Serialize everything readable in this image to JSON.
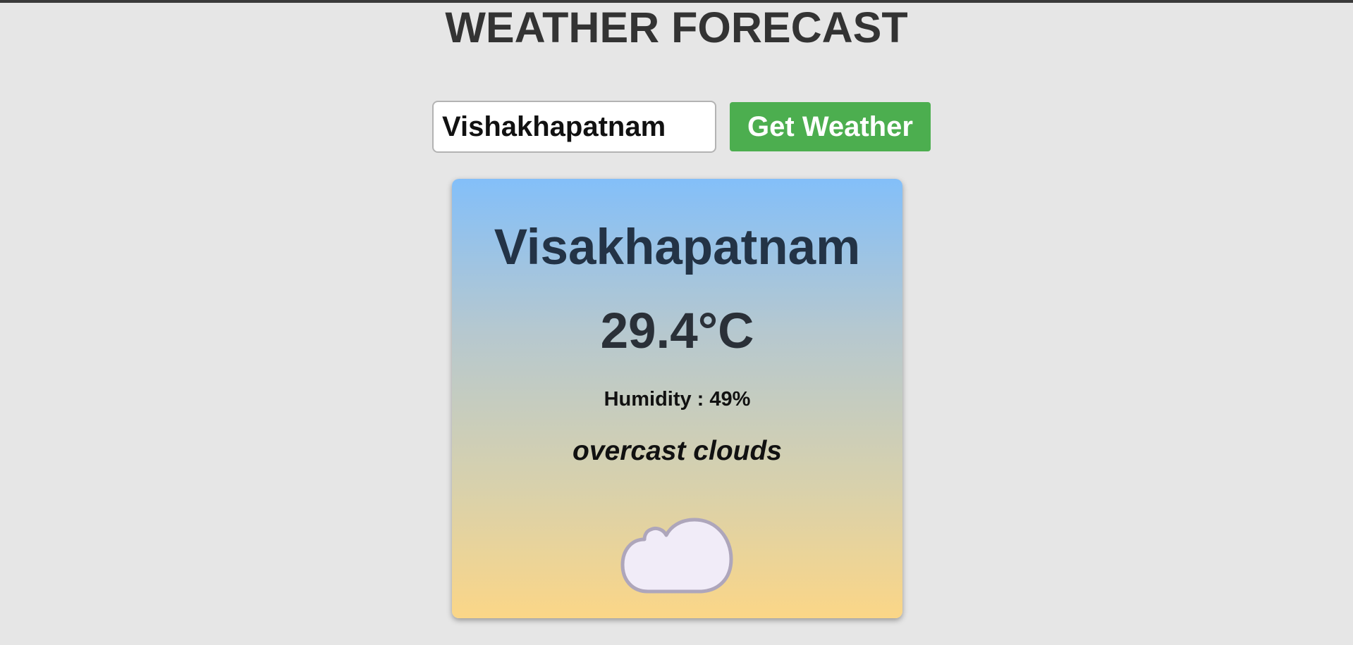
{
  "header": {
    "title": "WEATHER FORECAST"
  },
  "search": {
    "value": "Vishakhapatnam",
    "button_label": "Get Weather"
  },
  "weather": {
    "city": "Visakhapatnam",
    "temperature": "29.4°C",
    "humidity": "Humidity : 49%",
    "description": "overcast clouds",
    "icon": "cloud-icon"
  },
  "colors": {
    "background": "#e6e6e6",
    "button": "#4cae4f",
    "card_gradient_top": "#83bff9",
    "card_gradient_bottom": "#fbd687",
    "cloud_fill": "#f1ecf8",
    "cloud_stroke": "#aea6bb"
  }
}
